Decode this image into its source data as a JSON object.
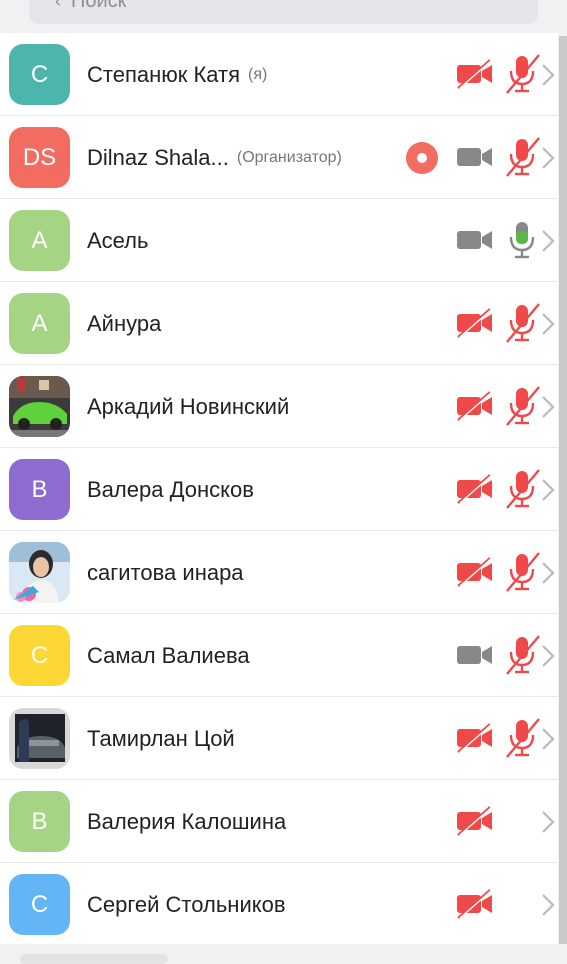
{
  "search": {
    "label": "Поиск"
  },
  "colors": {
    "muted_red": "#f0494a",
    "gray_icon": "#888888",
    "mic_green": "#5cb747",
    "record_red": "#f26c62"
  },
  "participants": [
    {
      "initials": "С",
      "name": "Степанюк Катя",
      "tag": "(я)",
      "avatar_color": "#4db6ac",
      "recording": false,
      "video": "off",
      "mic": "off"
    },
    {
      "initials": "DS",
      "name": "Dilnaz Shala...",
      "tag": "(Организатор)",
      "avatar_color": "#f26c62",
      "recording": true,
      "video": "on",
      "mic": "off"
    },
    {
      "initials": "А",
      "name": "Асель",
      "tag": "",
      "avatar_color": "#a5d584",
      "recording": false,
      "video": "on",
      "mic": "on"
    },
    {
      "initials": "А",
      "name": "Айнура",
      "tag": "",
      "avatar_color": "#a5d584",
      "recording": false,
      "video": "off",
      "mic": "off"
    },
    {
      "initials": "",
      "name": "Аркадий Новинский",
      "tag": "",
      "avatar_color": "photo-car",
      "recording": false,
      "video": "off",
      "mic": "off"
    },
    {
      "initials": "В",
      "name": "Валера Донсков",
      "tag": "",
      "avatar_color": "#8e6bcf",
      "recording": false,
      "video": "off",
      "mic": "off"
    },
    {
      "initials": "",
      "name": "сагитова инара",
      "tag": "",
      "avatar_color": "photo-woman",
      "recording": false,
      "video": "off",
      "mic": "off"
    },
    {
      "initials": "С",
      "name": "Самал Валиева",
      "tag": "",
      "avatar_color": "#fdd835",
      "recording": false,
      "video": "on",
      "mic": "off"
    },
    {
      "initials": "",
      "name": "Тамирлан Цой",
      "tag": "",
      "avatar_color": "photo-dark-car",
      "recording": false,
      "video": "off",
      "mic": "off"
    },
    {
      "initials": "В",
      "name": "Валерия Калошина",
      "tag": "",
      "avatar_color": "#a5d584",
      "recording": false,
      "video": "off",
      "mic": "none"
    },
    {
      "initials": "С",
      "name": "Сергей Стольников",
      "tag": "",
      "avatar_color": "#64b5f6",
      "recording": false,
      "video": "off",
      "mic": "none"
    }
  ]
}
